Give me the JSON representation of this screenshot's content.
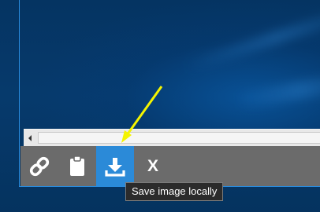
{
  "toolbar": {
    "buttons": [
      {
        "icon": "link-icon"
      },
      {
        "icon": "clipboard-icon"
      },
      {
        "icon": "download-icon",
        "active": true
      },
      {
        "label": "X"
      }
    ]
  },
  "tooltip": {
    "text": "Save image locally"
  },
  "colors": {
    "toolbar_bg": "#6b6b6b",
    "active_button": "#2b8ad8",
    "annotation_arrow": "#f4f400",
    "desktop": "#06335f"
  }
}
